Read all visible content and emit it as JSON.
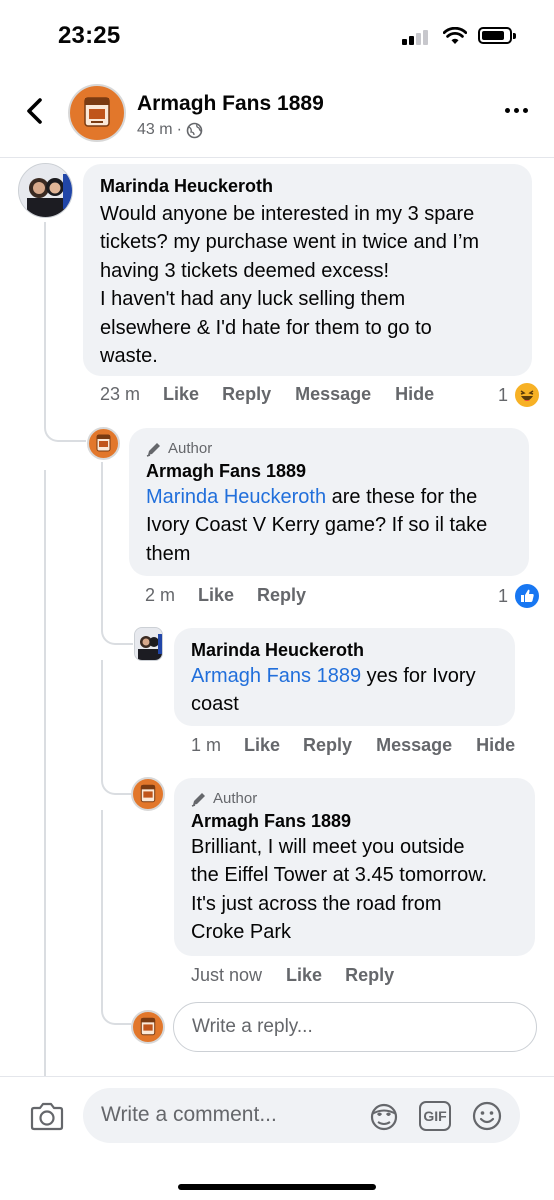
{
  "status_bar": {
    "time": "23:25"
  },
  "header": {
    "group_name": "Armagh Fans 1889",
    "age": "43 m",
    "separator": "·",
    "privacy_icon": "globe-icon"
  },
  "colors": {
    "mention": "#216fdb",
    "bubble": "#f0f2f5",
    "muted": "#65676b",
    "group_orange": "#e2772b",
    "like_blue": "#1877f2"
  },
  "comments": [
    {
      "author": "Marinda Heuckeroth",
      "lines": [
        "Would anyone be interested in my 3 spare",
        "tickets? my purchase went in twice and I’m",
        "having 3 tickets deemed excess!",
        "I haven't had any luck selling them",
        "elsewhere & I'd hate for them to go to",
        "waste."
      ],
      "time": "23 m",
      "actions": [
        "Like",
        "Reply",
        "Message",
        "Hide"
      ],
      "reaction_count": "1",
      "reaction_icon": "haha-emoji-icon"
    },
    {
      "badge": "Author",
      "author": "Armagh Fans 1889",
      "mention": "Marinda Heuckeroth",
      "line1_rest": " are these for the",
      "lines": [
        "Ivory Coast V Kerry game? If so il take",
        "them"
      ],
      "time": "2 m",
      "actions": [
        "Like",
        "Reply"
      ],
      "reaction_count": "1",
      "reaction_icon": "like-thumb-icon"
    },
    {
      "author": "Marinda Heuckeroth",
      "mention": "Armagh Fans 1889",
      "line1_rest": " yes for Ivory",
      "lines": [
        "coast"
      ],
      "time": "1 m",
      "actions": [
        "Like",
        "Reply",
        "Message",
        "Hide"
      ]
    },
    {
      "badge": "Author",
      "author": "Armagh Fans 1889",
      "lines": [
        "Brilliant, I will meet you outside",
        "the Eiffel Tower at 3.45 tomorrow.",
        "It's just across the road from",
        "Croke Park"
      ],
      "time": "Just now",
      "actions": [
        "Like",
        "Reply"
      ]
    }
  ],
  "reply_input": {
    "placeholder": "Write a reply..."
  },
  "comment_bar": {
    "placeholder": "Write a comment...",
    "gif_label": "GIF"
  }
}
